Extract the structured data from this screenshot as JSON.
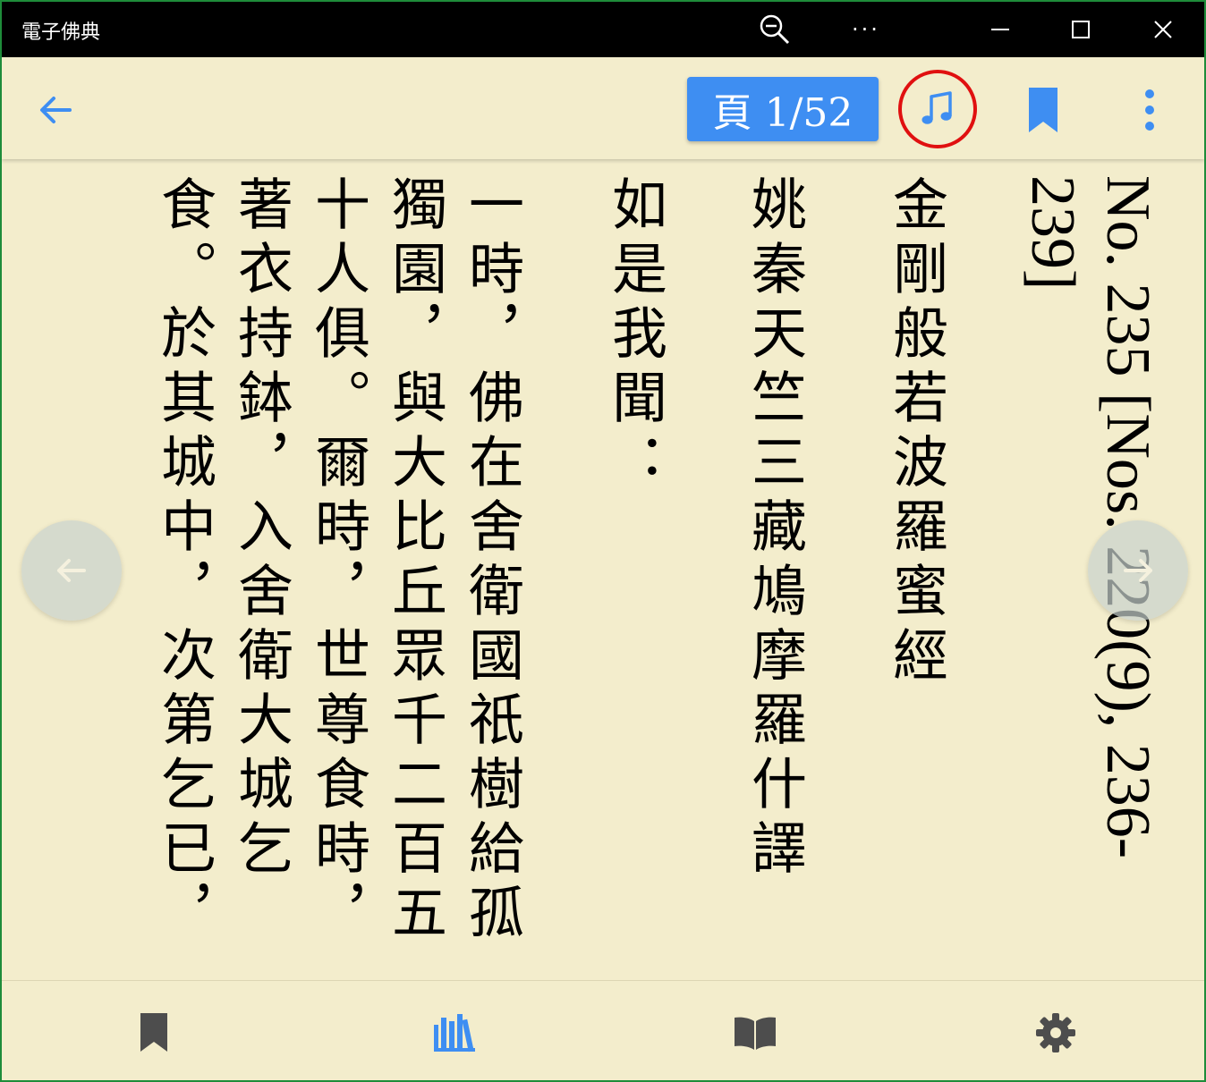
{
  "window": {
    "title": "電子佛典",
    "border_color": "#1e8c3a",
    "controls": [
      "zoom-out-icon",
      "more-icon",
      "minimize-icon",
      "maximize-icon",
      "close-icon"
    ],
    "more_label": "···"
  },
  "toolbar": {
    "back_icon": "arrow-left-icon",
    "page_label": "頁 1/52",
    "page_button_color": "#3e8ef2",
    "music_icon": "music-note-icon",
    "music_highlight_color": "#e01010",
    "bookmark_icon": "bookmark-icon",
    "menu_icon": "more-vertical-icon",
    "accent_color": "#3e8ef2"
  },
  "document": {
    "number": "No. 235 [Nos. 220(9), 236-239]",
    "title": "金剛般若波羅蜜經",
    "translator": "姚秦天竺三藏鳩摩羅什譯",
    "intro": "如是我聞：",
    "paragraph_lines": [
      "一時，佛在舍衛國祇樹給孤",
      "獨園，與大比丘眾千二百五",
      "十人俱。爾時，世尊食時，",
      "著衣持鉢，入舍衛大城乞",
      "食。於其城中，次第乞已，"
    ]
  },
  "page_nav": {
    "prev_icon": "arrow-left-icon",
    "next_icon": "arrow-right-icon"
  },
  "bottom_nav": [
    {
      "name": "bookmarks",
      "icon": "bookmark-icon",
      "active": false
    },
    {
      "name": "library",
      "icon": "library-icon",
      "active": true
    },
    {
      "name": "reading",
      "icon": "open-book-icon",
      "active": false
    },
    {
      "name": "settings",
      "icon": "gear-icon",
      "active": false
    }
  ],
  "colors": {
    "background": "#f3edcc",
    "inactive_icon": "#4d4d4d",
    "active_icon": "#3e8ef2"
  }
}
